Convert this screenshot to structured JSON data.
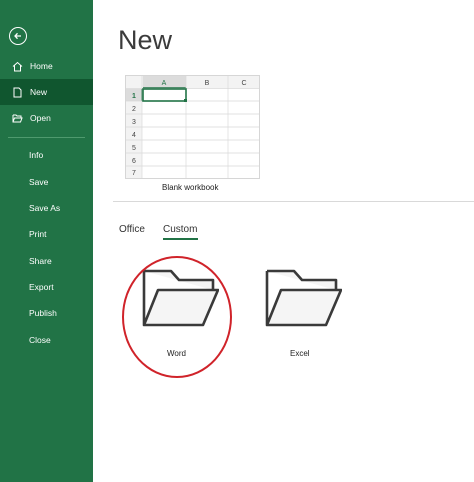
{
  "sidebar": {
    "back_icon": "back-arrow-icon",
    "items": [
      {
        "label": "Home",
        "icon": "home-icon"
      },
      {
        "label": "New",
        "icon": "new-doc-icon"
      },
      {
        "label": "Open",
        "icon": "open-folder-icon"
      },
      {
        "label": "Info"
      },
      {
        "label": "Save"
      },
      {
        "label": "Save As"
      },
      {
        "label": "Print"
      },
      {
        "label": "Share"
      },
      {
        "label": "Export"
      },
      {
        "label": "Publish"
      },
      {
        "label": "Close"
      }
    ],
    "selected": "New",
    "colors": {
      "bg": "#217346",
      "selected": "#10562f"
    }
  },
  "main": {
    "title": "New",
    "blank_workbook": {
      "label": "Blank workbook",
      "columns": [
        "A",
        "B",
        "C"
      ],
      "rows": [
        "1",
        "2",
        "3",
        "4",
        "5",
        "6",
        "7"
      ]
    },
    "tabs": [
      {
        "label": "Office"
      },
      {
        "label": "Custom",
        "active": true
      }
    ],
    "templates": [
      {
        "label": "Word",
        "icon": "folder-icon"
      },
      {
        "label": "Excel",
        "icon": "folder-icon"
      }
    ],
    "annotation_color": "#d0232a"
  }
}
